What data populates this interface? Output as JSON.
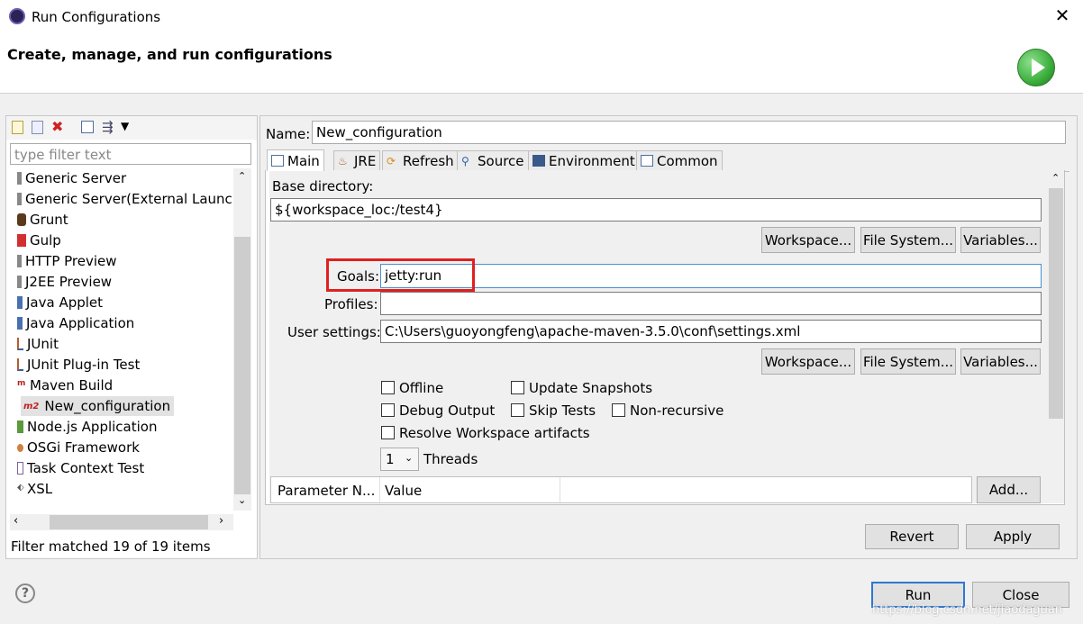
{
  "window": {
    "title": "Run Configurations",
    "header": "Create, manage, and run configurations"
  },
  "left": {
    "filter_placeholder": "type filter text",
    "items": [
      {
        "label": "Generic Server",
        "icon": "generic-server-icon"
      },
      {
        "label": "Generic Server(External Launch)",
        "icon": "generic-server-icon"
      },
      {
        "label": "Grunt",
        "icon": "grunt-icon"
      },
      {
        "label": "Gulp",
        "icon": "gulp-icon"
      },
      {
        "label": "HTTP Preview",
        "icon": "http-preview-icon"
      },
      {
        "label": "J2EE Preview",
        "icon": "j2ee-preview-icon"
      },
      {
        "label": "Java Applet",
        "icon": "java-applet-icon"
      },
      {
        "label": "Java Application",
        "icon": "java-application-icon"
      },
      {
        "label": "JUnit",
        "icon": "junit-icon"
      },
      {
        "label": "JUnit Plug-in Test",
        "icon": "junit-plugin-icon"
      },
      {
        "label": "Maven Build",
        "icon": "maven-icon"
      },
      {
        "label": "New_configuration",
        "icon": "m2-icon",
        "icon_text": "m2"
      },
      {
        "label": "Node.js Application",
        "icon": "nodejs-icon"
      },
      {
        "label": "OSGi Framework",
        "icon": "osgi-icon"
      },
      {
        "label": "Task Context Test",
        "icon": "task-context-icon"
      },
      {
        "label": "XSL",
        "icon": "xsl-icon"
      }
    ],
    "status": "Filter matched 19 of 19 items"
  },
  "right": {
    "name_label": "Name:",
    "name_value": "New_configuration",
    "tabs": [
      "Main",
      "JRE",
      "Refresh",
      "Source",
      "Environment",
      "Common"
    ],
    "base_dir_label": "Base directory:",
    "base_dir_value": "${workspace_loc:/test4}",
    "workspace_btn": "Workspace...",
    "filesystem_btn": "File System...",
    "variables_btn": "Variables...",
    "goals_label": "Goals:",
    "goals_value": "jetty:run",
    "profiles_label": "Profiles:",
    "profiles_value": "",
    "user_settings_label": "User settings:",
    "user_settings_value": "C:\\Users\\guoyongfeng\\apache-maven-3.5.0\\conf\\settings.xml",
    "offline": "Offline",
    "update_snapshots": "Update Snapshots",
    "debug_output": "Debug Output",
    "skip_tests": "Skip Tests",
    "non_recursive": "Non-recursive",
    "resolve_ws": "Resolve Workspace artifacts",
    "threads_value": "1",
    "threads_label": "Threads",
    "param_col1": "Parameter N...",
    "param_col2": "Value",
    "add_btn": "Add...",
    "revert_btn": "Revert",
    "apply_btn": "Apply"
  },
  "footer": {
    "help": "?",
    "run_btn": "Run",
    "close_btn": "Close",
    "watermark": "https://blog.csdn.net/jiaodaguan"
  },
  "colors": {
    "highlight_box": "#e02020",
    "run_icon_green": "#3cae3c"
  }
}
